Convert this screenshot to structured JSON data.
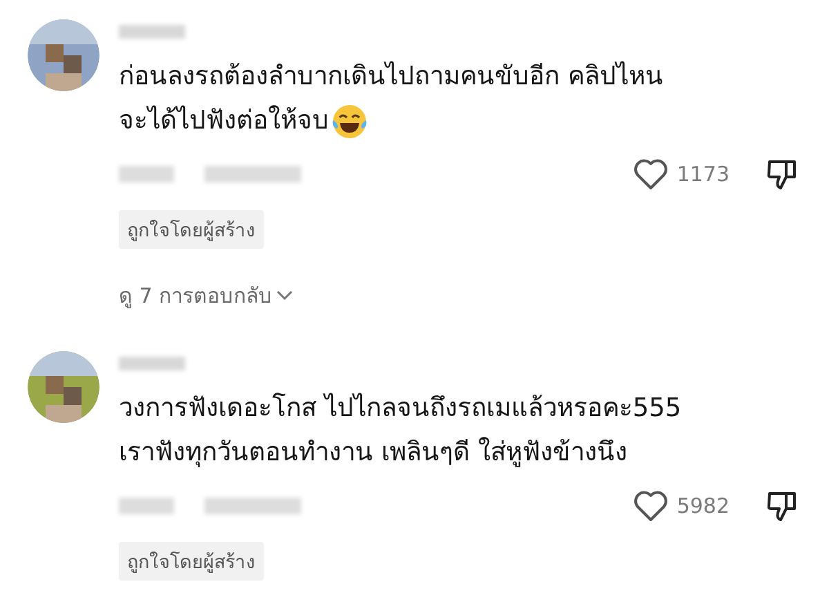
{
  "comments": [
    {
      "lines": [
        "ก่อนลงรถต้องลำบากเดินไปถามคนขับอีก คลิปไหน",
        "จะได้ไปฟังต่อให้จบ"
      ],
      "laughing_emoji": true,
      "likes": "1173",
      "liked_by_creator": "ถูกใจโดยผู้สร้าง",
      "replies": "ดู 7 การตอบกลับ"
    },
    {
      "lines": [
        "วงการฟังเดอะโกส ไปไกลจนถึงรถเมแล้วหรอคะ555",
        "เราฟังทุกวันตอนทำงาน เพลินๆดี ใส่หูฟังข้างนึง"
      ],
      "laughing_emoji": false,
      "likes": "5982",
      "liked_by_creator": "ถูกใจโดยผู้สร้าง"
    }
  ]
}
